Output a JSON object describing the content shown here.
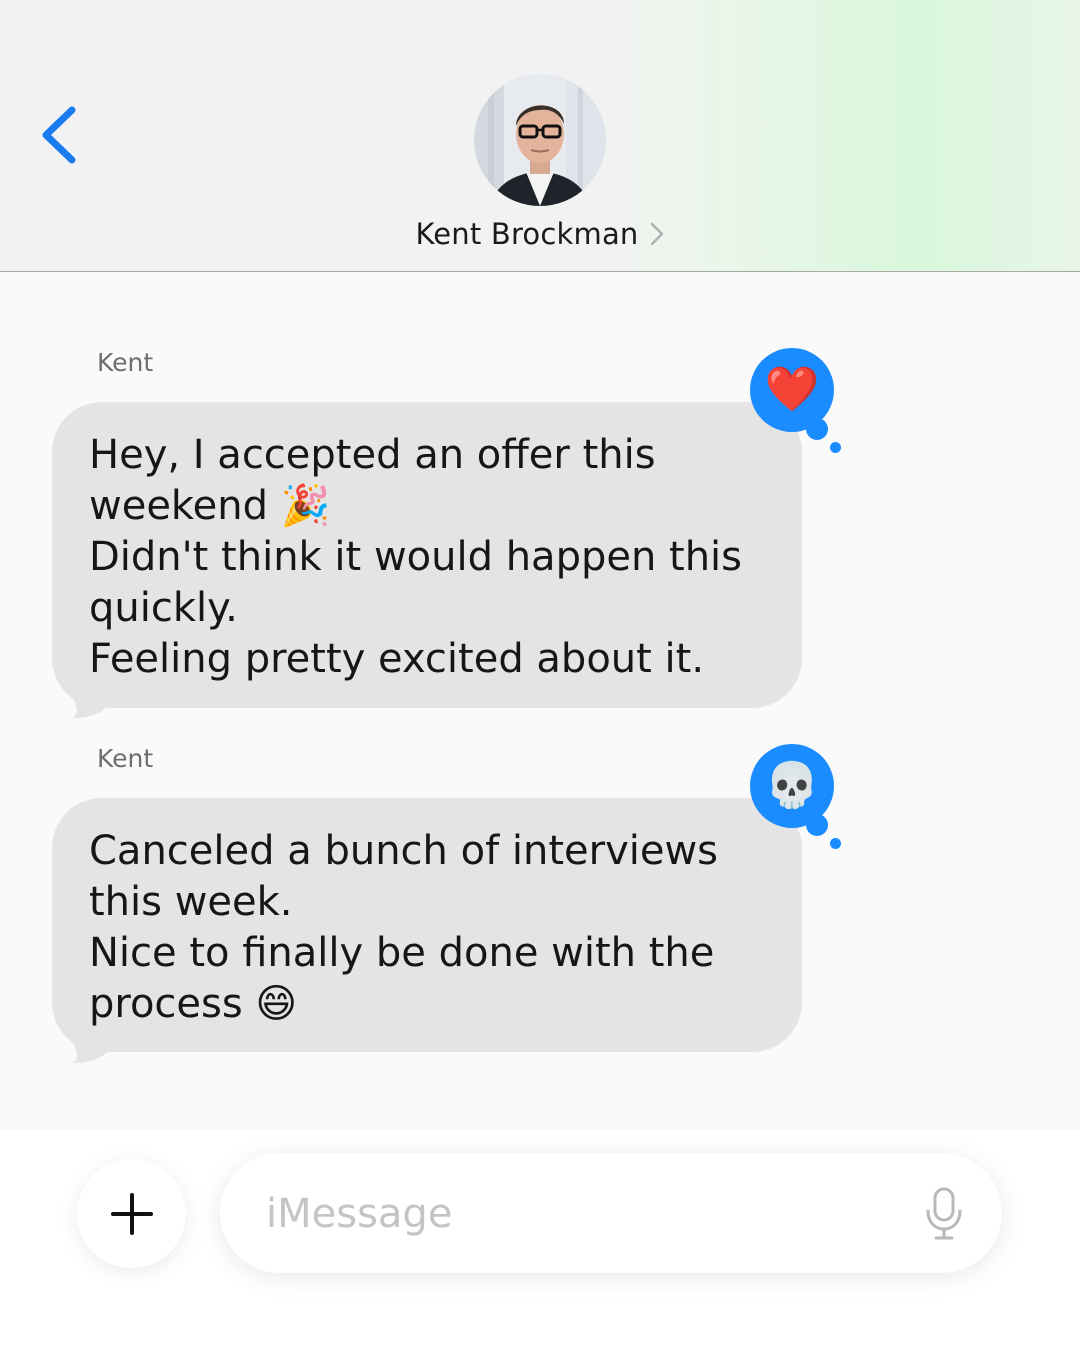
{
  "header": {
    "contact_name": "Kent Brockman",
    "back_icon": "chevron-left-icon",
    "detail_icon": "chevron-right-icon",
    "accent_color": "#1a7cf0"
  },
  "messages": [
    {
      "sender": "Kent",
      "text": "Hey, I accepted an offer this\nweekend 🎉\nDidn't think it would happen this\nquickly.\nFeeling pretty excited about it.",
      "tapback": "❤️",
      "tapback_name": "heart-tapback"
    },
    {
      "sender": "Kent",
      "text": "Canceled a bunch of interviews\nthis week.\nNice to finally be done with the\nprocess 😄",
      "tapback": "💀",
      "tapback_name": "skull-tapback"
    }
  ],
  "composer": {
    "placeholder": "iMessage",
    "plus_icon": "plus-icon",
    "mic_icon": "microphone-icon"
  },
  "colors": {
    "bubble": "#e4e4e4",
    "tapback": "#1a8cff"
  }
}
